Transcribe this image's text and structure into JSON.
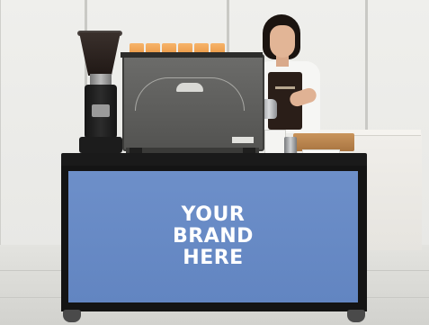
{
  "scene": {
    "description_type": "photo",
    "background_color": "#ecece9"
  },
  "cart": {
    "panel_color": "#6789c4",
    "frame_color": "#141414",
    "brand_lines": [
      "YOUR",
      "BRAND",
      "HERE"
    ],
    "brand_text_color": "#ffffff"
  },
  "cups": {
    "count": 6,
    "color": "#f0a250"
  }
}
